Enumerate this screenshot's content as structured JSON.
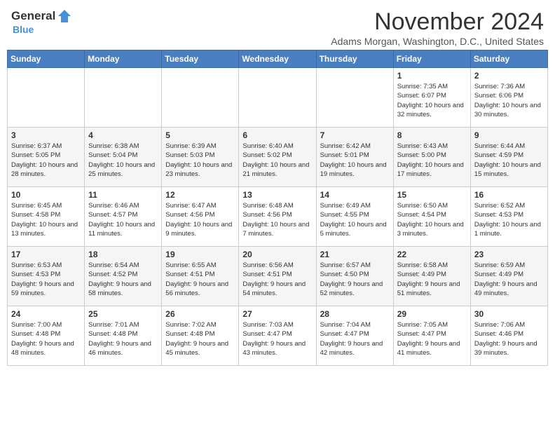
{
  "header": {
    "logo_general": "General",
    "logo_blue": "Blue",
    "month": "November 2024",
    "location": "Adams Morgan, Washington, D.C., United States"
  },
  "weekdays": [
    "Sunday",
    "Monday",
    "Tuesday",
    "Wednesday",
    "Thursday",
    "Friday",
    "Saturday"
  ],
  "weeks": [
    [
      {
        "day": "",
        "info": ""
      },
      {
        "day": "",
        "info": ""
      },
      {
        "day": "",
        "info": ""
      },
      {
        "day": "",
        "info": ""
      },
      {
        "day": "",
        "info": ""
      },
      {
        "day": "1",
        "info": "Sunrise: 7:35 AM\nSunset: 6:07 PM\nDaylight: 10 hours and 32 minutes."
      },
      {
        "day": "2",
        "info": "Sunrise: 7:36 AM\nSunset: 6:06 PM\nDaylight: 10 hours and 30 minutes."
      }
    ],
    [
      {
        "day": "3",
        "info": "Sunrise: 6:37 AM\nSunset: 5:05 PM\nDaylight: 10 hours and 28 minutes."
      },
      {
        "day": "4",
        "info": "Sunrise: 6:38 AM\nSunset: 5:04 PM\nDaylight: 10 hours and 25 minutes."
      },
      {
        "day": "5",
        "info": "Sunrise: 6:39 AM\nSunset: 5:03 PM\nDaylight: 10 hours and 23 minutes."
      },
      {
        "day": "6",
        "info": "Sunrise: 6:40 AM\nSunset: 5:02 PM\nDaylight: 10 hours and 21 minutes."
      },
      {
        "day": "7",
        "info": "Sunrise: 6:42 AM\nSunset: 5:01 PM\nDaylight: 10 hours and 19 minutes."
      },
      {
        "day": "8",
        "info": "Sunrise: 6:43 AM\nSunset: 5:00 PM\nDaylight: 10 hours and 17 minutes."
      },
      {
        "day": "9",
        "info": "Sunrise: 6:44 AM\nSunset: 4:59 PM\nDaylight: 10 hours and 15 minutes."
      }
    ],
    [
      {
        "day": "10",
        "info": "Sunrise: 6:45 AM\nSunset: 4:58 PM\nDaylight: 10 hours and 13 minutes."
      },
      {
        "day": "11",
        "info": "Sunrise: 6:46 AM\nSunset: 4:57 PM\nDaylight: 10 hours and 11 minutes."
      },
      {
        "day": "12",
        "info": "Sunrise: 6:47 AM\nSunset: 4:56 PM\nDaylight: 10 hours and 9 minutes."
      },
      {
        "day": "13",
        "info": "Sunrise: 6:48 AM\nSunset: 4:56 PM\nDaylight: 10 hours and 7 minutes."
      },
      {
        "day": "14",
        "info": "Sunrise: 6:49 AM\nSunset: 4:55 PM\nDaylight: 10 hours and 5 minutes."
      },
      {
        "day": "15",
        "info": "Sunrise: 6:50 AM\nSunset: 4:54 PM\nDaylight: 10 hours and 3 minutes."
      },
      {
        "day": "16",
        "info": "Sunrise: 6:52 AM\nSunset: 4:53 PM\nDaylight: 10 hours and 1 minute."
      }
    ],
    [
      {
        "day": "17",
        "info": "Sunrise: 6:53 AM\nSunset: 4:53 PM\nDaylight: 9 hours and 59 minutes."
      },
      {
        "day": "18",
        "info": "Sunrise: 6:54 AM\nSunset: 4:52 PM\nDaylight: 9 hours and 58 minutes."
      },
      {
        "day": "19",
        "info": "Sunrise: 6:55 AM\nSunset: 4:51 PM\nDaylight: 9 hours and 56 minutes."
      },
      {
        "day": "20",
        "info": "Sunrise: 6:56 AM\nSunset: 4:51 PM\nDaylight: 9 hours and 54 minutes."
      },
      {
        "day": "21",
        "info": "Sunrise: 6:57 AM\nSunset: 4:50 PM\nDaylight: 9 hours and 52 minutes."
      },
      {
        "day": "22",
        "info": "Sunrise: 6:58 AM\nSunset: 4:49 PM\nDaylight: 9 hours and 51 minutes."
      },
      {
        "day": "23",
        "info": "Sunrise: 6:59 AM\nSunset: 4:49 PM\nDaylight: 9 hours and 49 minutes."
      }
    ],
    [
      {
        "day": "24",
        "info": "Sunrise: 7:00 AM\nSunset: 4:48 PM\nDaylight: 9 hours and 48 minutes."
      },
      {
        "day": "25",
        "info": "Sunrise: 7:01 AM\nSunset: 4:48 PM\nDaylight: 9 hours and 46 minutes."
      },
      {
        "day": "26",
        "info": "Sunrise: 7:02 AM\nSunset: 4:48 PM\nDaylight: 9 hours and 45 minutes."
      },
      {
        "day": "27",
        "info": "Sunrise: 7:03 AM\nSunset: 4:47 PM\nDaylight: 9 hours and 43 minutes."
      },
      {
        "day": "28",
        "info": "Sunrise: 7:04 AM\nSunset: 4:47 PM\nDaylight: 9 hours and 42 minutes."
      },
      {
        "day": "29",
        "info": "Sunrise: 7:05 AM\nSunset: 4:47 PM\nDaylight: 9 hours and 41 minutes."
      },
      {
        "day": "30",
        "info": "Sunrise: 7:06 AM\nSunset: 4:46 PM\nDaylight: 9 hours and 39 minutes."
      }
    ]
  ]
}
